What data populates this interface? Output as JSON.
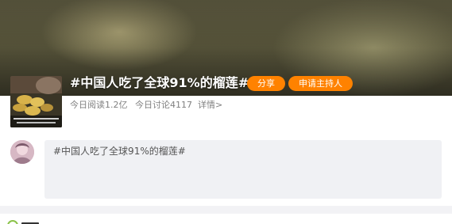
{
  "topic": {
    "title": "#中国人吃了全球91%的榴莲#",
    "share_label": "分享",
    "host_apply_label": "申请主持人",
    "read_today": "今日阅读1.2亿",
    "discuss_today": "今日讨论4117",
    "detail_link": "详情>"
  },
  "composer": {
    "prefill_text": "#中国人吃了全球91%的榴莲#"
  },
  "icons": {
    "topic_thumbnail": "durian-thumbnail-image",
    "user_avatar": "user-avatar-image",
    "bottom_section": "circle-icon"
  },
  "colors": {
    "accent": "#ff8200",
    "composer_bg": "#f0f1f4",
    "meta_text": "#808080"
  }
}
